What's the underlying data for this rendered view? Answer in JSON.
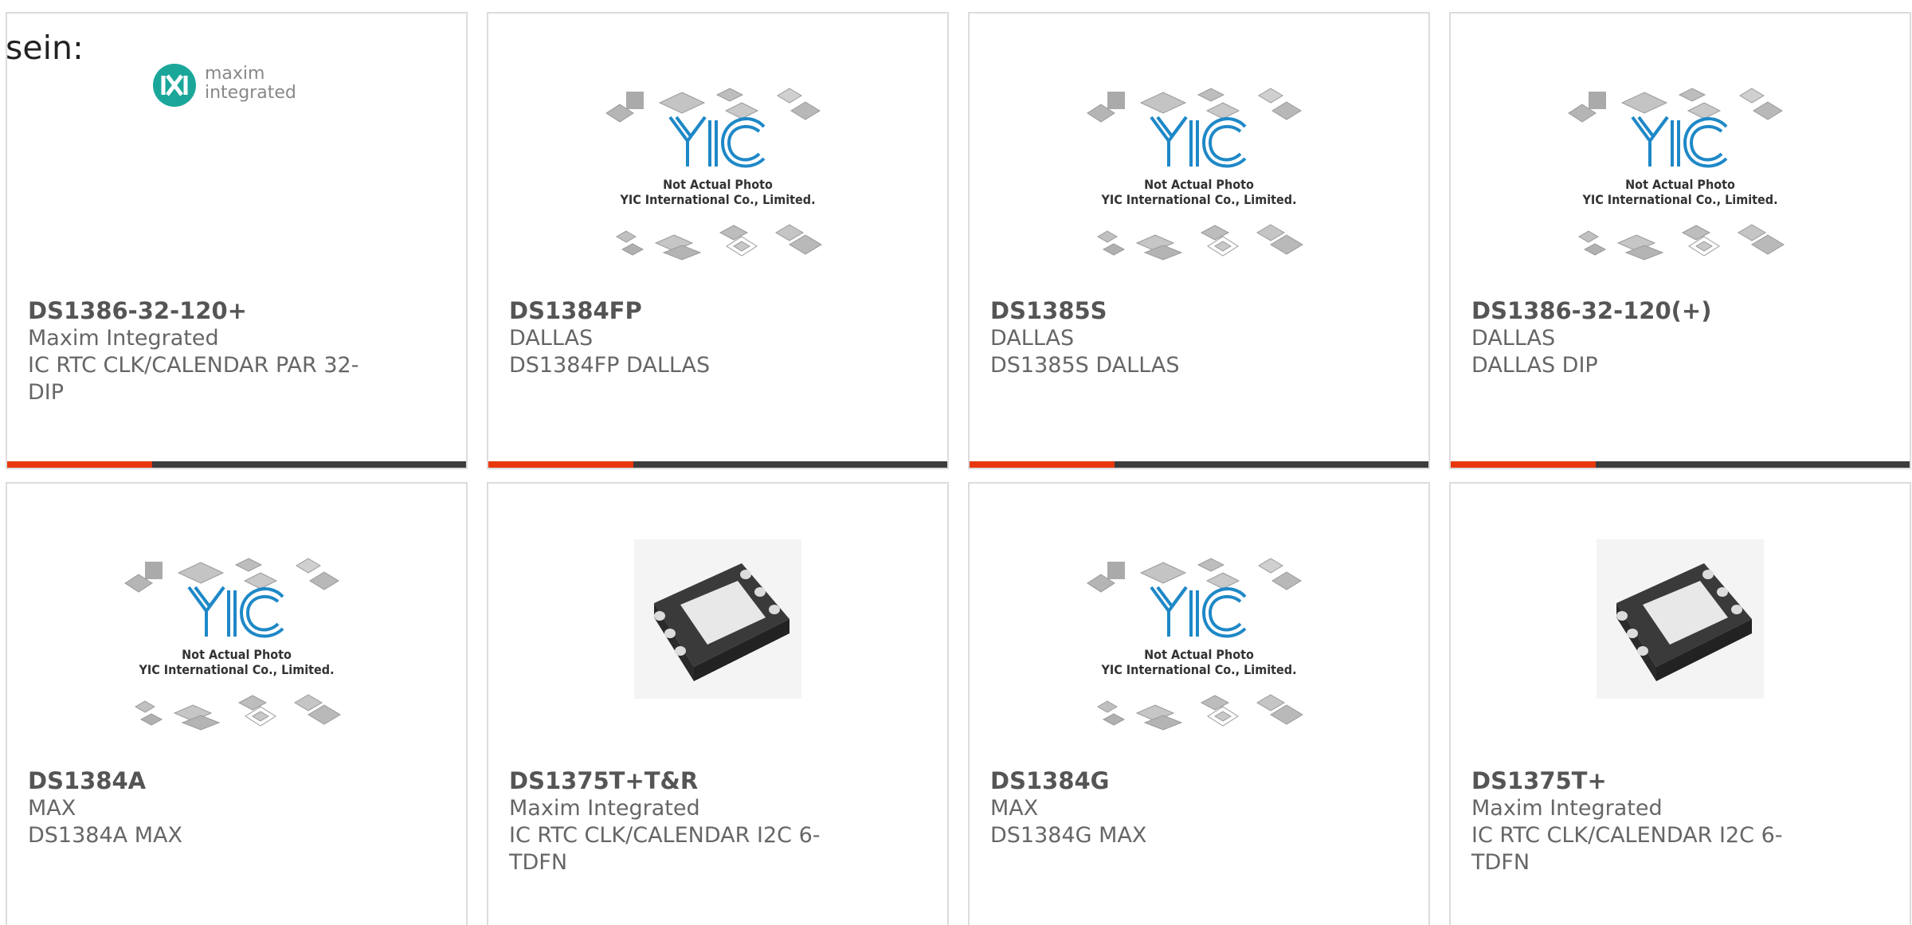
{
  "header": {
    "label": "sein:"
  },
  "colors": {
    "accent": "#e8380d",
    "bar": "#3c3c3c",
    "yic_blue": "#1e88c7"
  },
  "placeholder": {
    "line1": "Not Actual Photo",
    "line2": "YIC International Co., Limited."
  },
  "products": [
    {
      "part": "DS1386-32-120+",
      "manufacturer": "Maxim Integrated",
      "description": "IC RTC CLK/CALENDAR PAR 32-DIP",
      "image": "maxim-logo",
      "logo_text_1": "maxim",
      "logo_text_2": "integrated"
    },
    {
      "part": "DS1384FP",
      "manufacturer": "DALLAS",
      "description": "DS1384FP DALLAS",
      "image": "yic-placeholder"
    },
    {
      "part": "DS1385S",
      "manufacturer": "DALLAS",
      "description": "DS1385S DALLAS",
      "image": "yic-placeholder"
    },
    {
      "part": "DS1386-32-120(+)",
      "manufacturer": "DALLAS",
      "description": "DALLAS DIP",
      "image": "yic-placeholder"
    },
    {
      "part": "DS1384A",
      "manufacturer": "MAX",
      "description": "DS1384A MAX",
      "image": "yic-placeholder"
    },
    {
      "part": "DS1375T+T&R",
      "manufacturer": "Maxim Integrated",
      "description": "IC RTC CLK/CALENDAR I2C 6-TDFN",
      "image": "tdfn-chip"
    },
    {
      "part": "DS1384G",
      "manufacturer": "MAX",
      "description": "DS1384G MAX",
      "image": "yic-placeholder"
    },
    {
      "part": "DS1375T+",
      "manufacturer": "Maxim Integrated",
      "description": "IC RTC CLK/CALENDAR I2C 6-TDFN",
      "image": "tdfn-chip"
    }
  ]
}
